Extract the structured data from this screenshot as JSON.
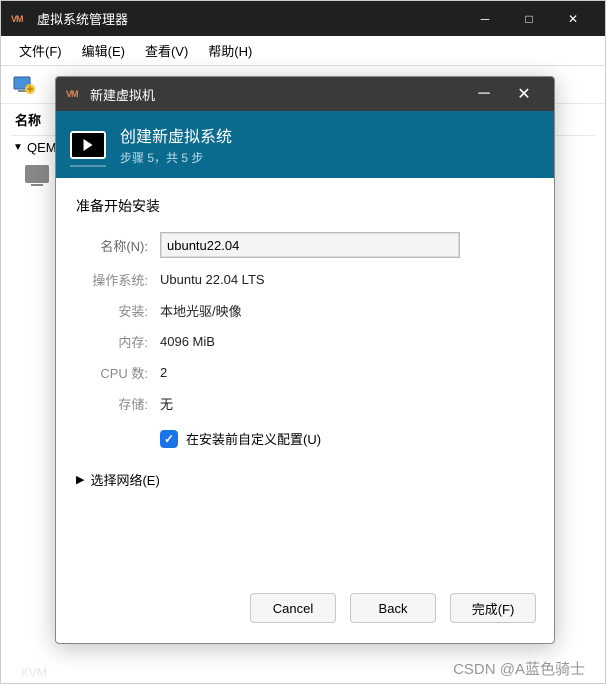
{
  "parent": {
    "title": "虚拟系统管理器",
    "menu": {
      "file": "文件(F)",
      "edit": "编辑(E)",
      "view": "查看(V)",
      "help": "帮助(H)"
    },
    "sidebar": {
      "header": "名称",
      "connection": "QEMU"
    }
  },
  "dialog": {
    "title": "新建虚拟机",
    "banner": {
      "heading": "创建新虚拟系统",
      "step": "步骤 5，共 5 步"
    },
    "ready_label": "准备开始安装",
    "fields": {
      "name_label": "名称(N):",
      "name_value": "ubuntu22.04",
      "os_label": "操作系统:",
      "os_value": "Ubuntu 22.04 LTS",
      "install_label": "安装:",
      "install_value": "本地光驱/映像",
      "memory_label": "内存:",
      "memory_value": "4096 MiB",
      "cpu_label": "CPU 数:",
      "cpu_value": "2",
      "storage_label": "存储:",
      "storage_value": "无"
    },
    "customize_label": "在安装前自定义配置(U)",
    "customize_checked": true,
    "network_expander": "选择网络(E)",
    "buttons": {
      "cancel": "Cancel",
      "back": "Back",
      "finish": "完成(F)"
    }
  },
  "watermark": "CSDN @A蓝色骑士",
  "bottom_blur_text": "KVM"
}
